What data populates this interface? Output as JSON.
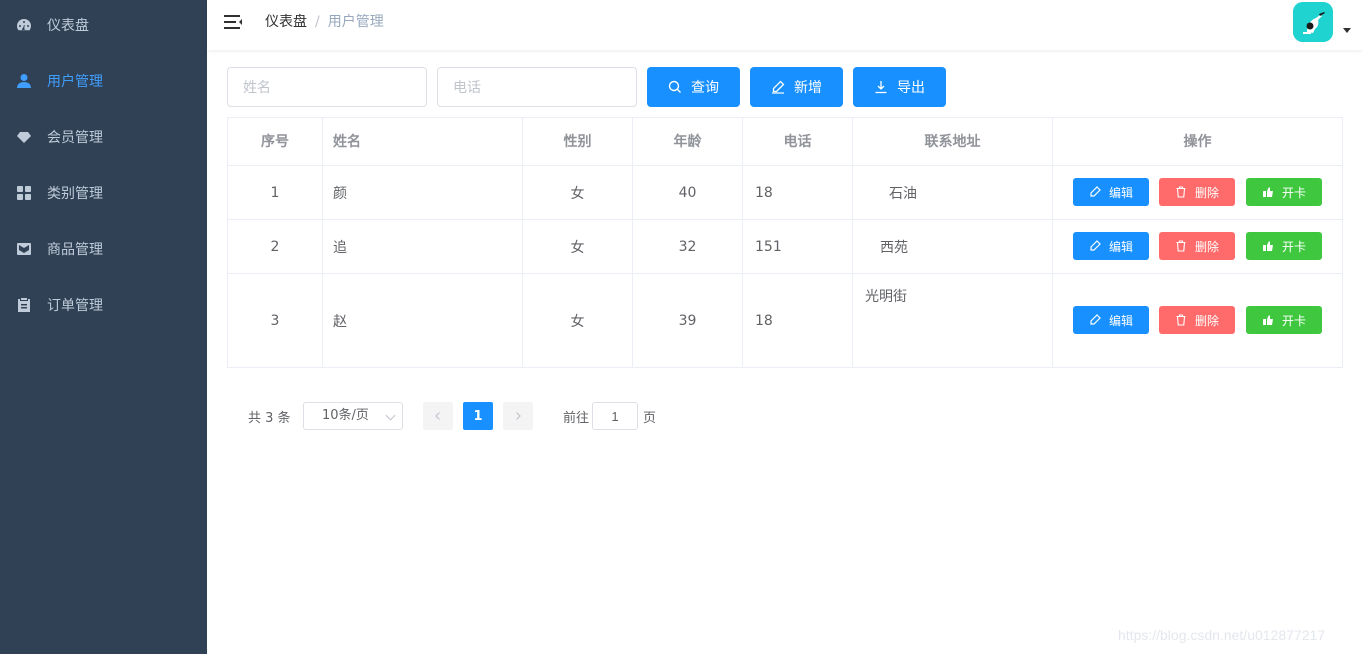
{
  "sidebar": {
    "items": [
      {
        "label": "仪表盘",
        "icon": "dashboard-icon",
        "active": false
      },
      {
        "label": "用户管理",
        "icon": "user-icon",
        "active": true
      },
      {
        "label": "会员管理",
        "icon": "diamond-icon",
        "active": false
      },
      {
        "label": "类别管理",
        "icon": "grid-icon",
        "active": false
      },
      {
        "label": "商品管理",
        "icon": "inbox-icon",
        "active": false
      },
      {
        "label": "订单管理",
        "icon": "clipboard-icon",
        "active": false
      }
    ]
  },
  "navbar": {
    "breadcrumb_home": "仪表盘",
    "breadcrumb_sep": "/",
    "breadcrumb_current": "用户管理"
  },
  "search": {
    "name_placeholder": "姓名",
    "phone_placeholder": "电话",
    "query_label": "查询",
    "add_label": "新增",
    "export_label": "导出"
  },
  "table": {
    "headers": [
      "序号",
      "姓名",
      "性别",
      "年龄",
      "电话",
      "联系地址",
      "操作"
    ],
    "rows": [
      {
        "index": "1",
        "name": "颜",
        "gender": "女",
        "age": "40",
        "phone": "18",
        "address": [
          "石油"
        ]
      },
      {
        "index": "2",
        "name": "追",
        "gender": "女",
        "age": "32",
        "phone": "151",
        "address": [
          "西苑"
        ]
      },
      {
        "index": "3",
        "name": "赵",
        "gender": "女",
        "age": "39",
        "phone": "18",
        "address": [
          "光明街"
        ]
      }
    ],
    "actions": {
      "edit": "编辑",
      "delete": "删除",
      "card": "开卡"
    }
  },
  "pagination": {
    "total": "共 3 条",
    "page_size": "10条/页",
    "current_page": "1",
    "goto_prefix": "前往",
    "goto_value": "1",
    "goto_suffix": "页"
  },
  "watermark": "https://blog.csdn.net/u012877217",
  "colors": {
    "sidebar_bg": "#304156",
    "primary": "#1890ff",
    "danger": "#ff6b6b",
    "success": "#3fc83f",
    "avatar_bg": "#1fd3d0"
  }
}
